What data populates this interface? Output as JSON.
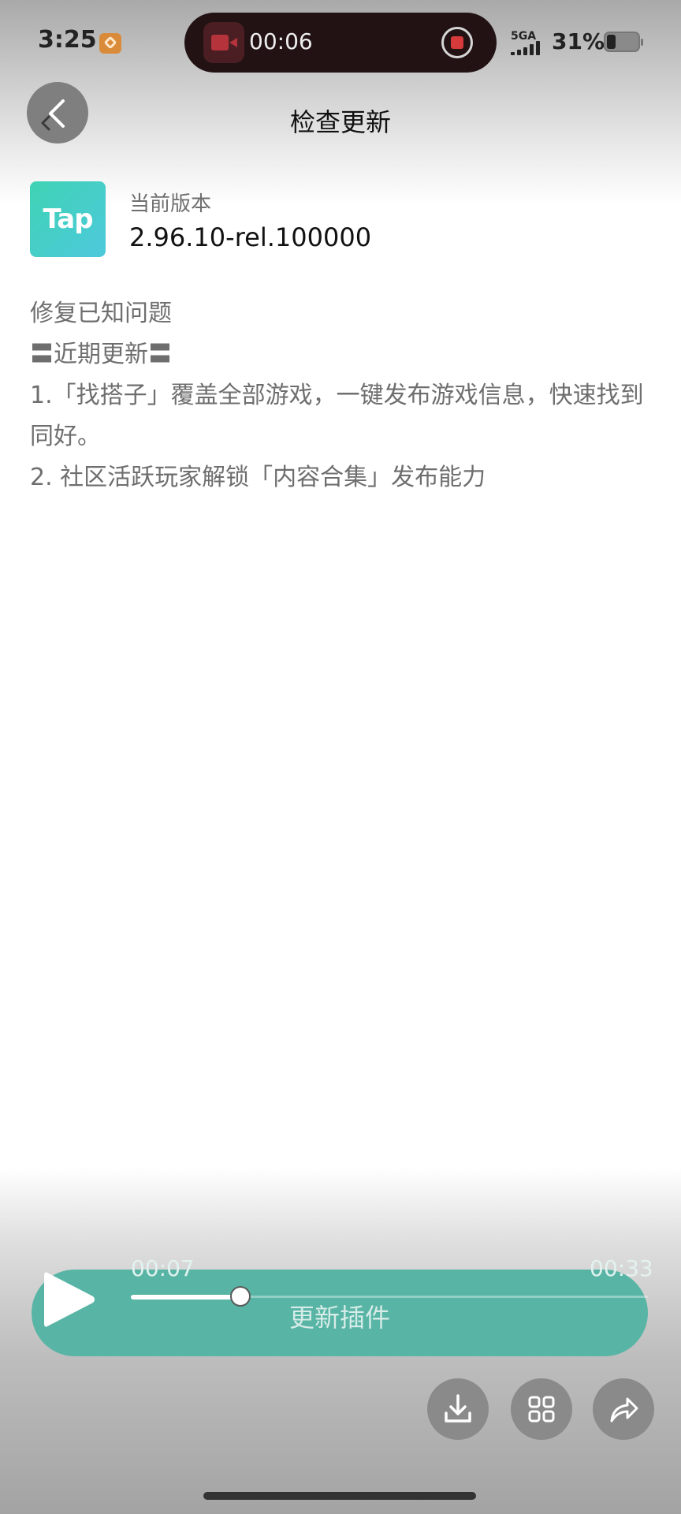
{
  "status_bar": {
    "time": "3:25",
    "recording_time": "00:06",
    "network": "5GA",
    "battery": "31%"
  },
  "header": {
    "title": "检查更新",
    "back_icon": "chevron-left-icon"
  },
  "version": {
    "logo_text": "Tap",
    "label": "当前版本",
    "value": "2.96.10-rel.100000"
  },
  "release_notes": [
    "修复已知问题",
    "〓近期更新〓",
    "1.「找搭子」覆盖全部游戏，一键发布游戏信息，快速找到同好。",
    "2. 社区活跃玩家解锁「内容合集」发布能力"
  ],
  "update_button": {
    "label": "更新插件"
  },
  "media_player": {
    "elapsed": "00:07",
    "total": "00:33",
    "progress": 0.212
  },
  "actions": [
    {
      "icon": "download-icon"
    },
    {
      "icon": "grid-icon"
    },
    {
      "icon": "share-icon"
    }
  ],
  "colors": {
    "accent": "#58b5a5",
    "logo_gradient_start": "#3fd3b4",
    "logo_gradient_end": "#4dc9dc",
    "recording_red": "#d63a3a"
  }
}
